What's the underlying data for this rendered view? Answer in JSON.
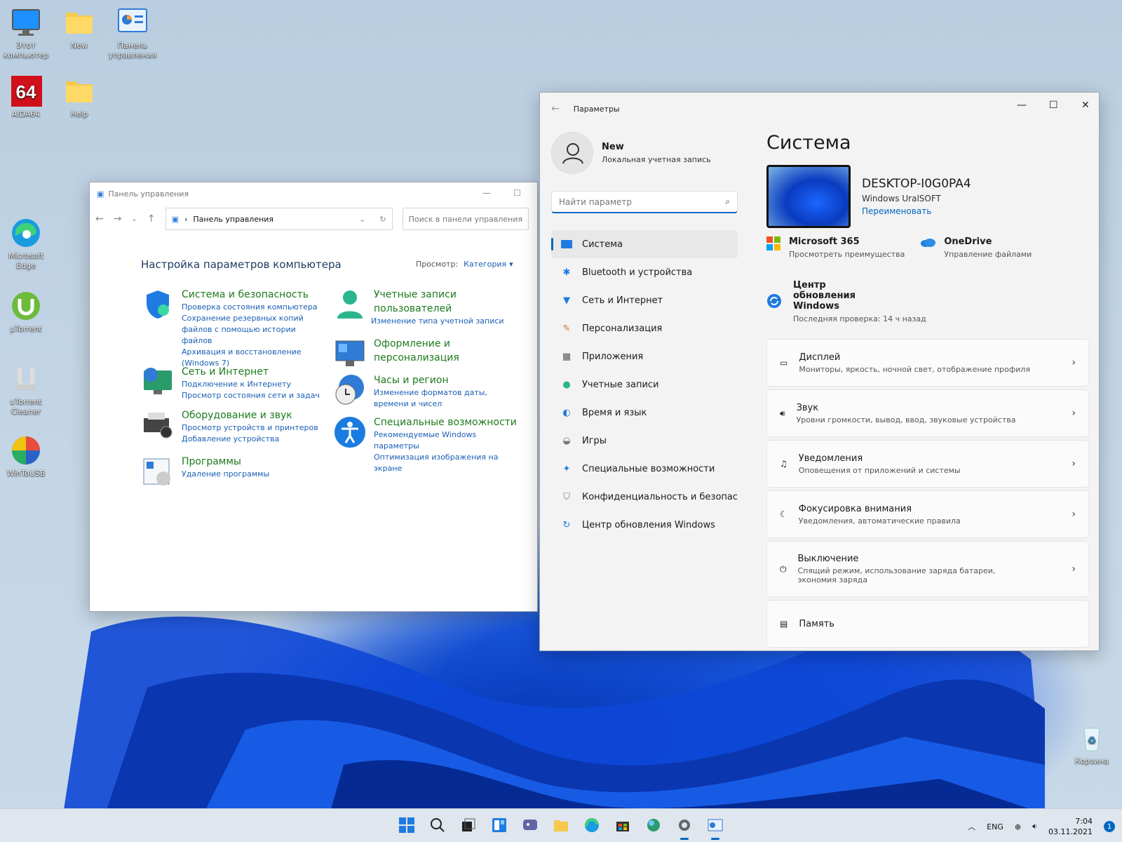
{
  "desktop": {
    "icons": [
      {
        "label": "Этот компьютер",
        "icon": "monitor-icon"
      },
      {
        "label": "New",
        "icon": "folder-icon"
      },
      {
        "label": "Панель управления",
        "icon": "control-panel-icon"
      },
      {
        "label": "AIDA64",
        "icon": "aida64-icon"
      },
      {
        "label": "Help",
        "icon": "folder-icon"
      },
      {
        "label": "Microsoft Edge",
        "icon": "edge-icon"
      },
      {
        "label": "µTorrent",
        "icon": "utorrent-icon"
      },
      {
        "label": "uTorrent Cleaner",
        "icon": "cleaner-icon"
      },
      {
        "label": "WinToUSB",
        "icon": "wintousb-icon"
      },
      {
        "label": "Корзина",
        "icon": "recycle-bin-icon"
      }
    ]
  },
  "control_panel": {
    "title": "Панель управления",
    "address": "Панель управления",
    "search_placeholder": "Поиск в панели управления",
    "heading": "Настройка параметров компьютера",
    "view_label": "Просмотр:",
    "view_value": "Категория",
    "categories": [
      {
        "title": "Система и безопасность",
        "links": [
          "Проверка состояния компьютера",
          "Сохранение резервных копий файлов с помощью истории файлов",
          "Архивация и восстановление (Windows 7)"
        ]
      },
      {
        "title": "Сеть и Интернет",
        "links": [
          "Подключение к Интернету",
          "Просмотр состояния сети и задач"
        ]
      },
      {
        "title": "Оборудование и звук",
        "links": [
          "Просмотр устройств и принтеров",
          "Добавление устройства"
        ]
      },
      {
        "title": "Программы",
        "links": [
          "Удаление программы"
        ]
      },
      {
        "title": "Учетные записи пользователей",
        "links": [
          "Изменение типа учетной записи"
        ]
      },
      {
        "title": "Оформление и персонализация",
        "links": []
      },
      {
        "title": "Часы и регион",
        "links": [
          "Изменение форматов даты, времени и чисел"
        ]
      },
      {
        "title": "Специальные возможности",
        "links": [
          "Рекомендуемые Windows параметры",
          "Оптимизация изображения на экране"
        ]
      }
    ]
  },
  "settings": {
    "title": "Параметры",
    "user_name": "New",
    "user_sub": "Локальная учетная запись",
    "search_placeholder": "Найти параметр",
    "nav": [
      {
        "label": "Система",
        "icon": "system-icon"
      },
      {
        "label": "Bluetooth и устройства",
        "icon": "bluetooth-icon"
      },
      {
        "label": "Сеть и Интернет",
        "icon": "wifi-icon"
      },
      {
        "label": "Персонализация",
        "icon": "brush-icon"
      },
      {
        "label": "Приложения",
        "icon": "apps-icon"
      },
      {
        "label": "Учетные записи",
        "icon": "person-icon"
      },
      {
        "label": "Время и язык",
        "icon": "globe-icon"
      },
      {
        "label": "Игры",
        "icon": "gamepad-icon"
      },
      {
        "label": "Специальные возможности",
        "icon": "accessibility-icon"
      },
      {
        "label": "Конфиденциальность и безопасность",
        "icon": "shield-icon"
      },
      {
        "label": "Центр обновления Windows",
        "icon": "update-icon"
      }
    ],
    "page_title": "Система",
    "pc_name": "DESKTOP-I0G0PA4",
    "pc_os": "Windows UralSOFT",
    "rename": "Переименовать",
    "services": [
      {
        "title": "Microsoft 365",
        "desc": "Просмотреть преимущества"
      },
      {
        "title": "OneDrive",
        "desc": "Управление файлами"
      }
    ],
    "update_title": "Центр обновления Windows",
    "update_desc": "Последняя проверка: 14 ч назад",
    "cards": [
      {
        "title": "Дисплей",
        "desc": "Мониторы, яркость, ночной свет, отображение профиля",
        "icon": "display-icon"
      },
      {
        "title": "Звук",
        "desc": "Уровни громкости, вывод, ввод, звуковые устройства",
        "icon": "speaker-icon"
      },
      {
        "title": "Уведомления",
        "desc": "Оповещения от приложений и системы",
        "icon": "bell-icon"
      },
      {
        "title": "Фокусировка внимания",
        "desc": "Уведомления, автоматические правила",
        "icon": "moon-icon"
      },
      {
        "title": "Выключение",
        "desc": "Спящий режим, использование заряда батареи, экономия заряда",
        "icon": "power-icon"
      },
      {
        "title": "Память",
        "desc": "",
        "icon": "storage-icon"
      }
    ]
  },
  "taskbar": {
    "lang": "ENG",
    "time": "7:04",
    "date": "03.11.2021",
    "badge": "1"
  }
}
